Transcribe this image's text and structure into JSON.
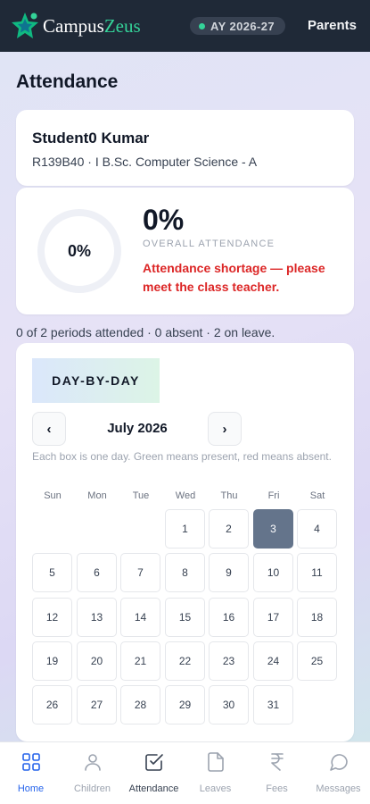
{
  "header": {
    "brand_part1": "Campus",
    "brand_part2": "Zeus",
    "year_pill": "AY 2026-27",
    "role": "Parents",
    "accent": "#34d399",
    "bar_color": "#1f2937"
  },
  "page_title": "Attendance",
  "student": {
    "name": "Student0 Kumar",
    "meta": "R139B40 · I B.Sc. Computer Science - A"
  },
  "overall": {
    "ring_value": "0%",
    "percent": "0%",
    "label": "OVERALL ATTENDANCE",
    "warning": "Attendance shortage — please meet the class teacher.",
    "fill_fraction": 0
  },
  "summary": "0 of 2 periods attended · 0 absent · 2 on leave.",
  "calendar": {
    "tab": "DAY-BY-DAY",
    "prev": "‹",
    "next": "›",
    "month": "July 2026",
    "help": "Each box is one day. Green means present, red means absent.",
    "weekdays": [
      "Sun",
      "Mon",
      "Tue",
      "Wed",
      "Thu",
      "Fri",
      "Sat"
    ],
    "first_weekday_index": 3,
    "days_in_month": 31,
    "selected_day": 3
  },
  "nav": {
    "items": [
      {
        "label": "Home",
        "icon": "grid-icon"
      },
      {
        "label": "Children",
        "icon": "person-icon"
      },
      {
        "label": "Attendance",
        "icon": "check-square-icon"
      },
      {
        "label": "Leaves",
        "icon": "document-icon"
      },
      {
        "label": "Fees",
        "icon": "rupee-icon"
      },
      {
        "label": "Messages",
        "icon": "chat-bubble-icon"
      }
    ],
    "active_index": 0,
    "current_index": 2,
    "active_color": "#2563eb"
  }
}
